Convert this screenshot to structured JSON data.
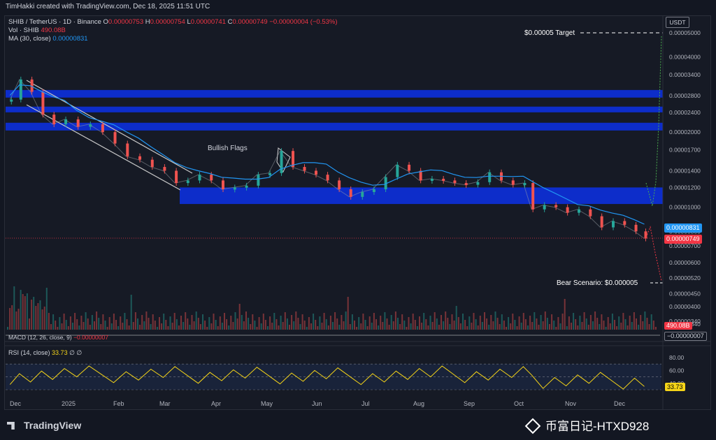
{
  "header": {
    "credit": "TimHakki created with TradingView.com, Dec 18, 2025 11:51 UTC"
  },
  "legend": {
    "symbol": "SHIB / TetherUS · 1D · Binance",
    "o_label": "O",
    "o_value": "0.00000753",
    "h_label": "H",
    "h_value": "0.00000754",
    "l_label": "L",
    "l_value": "0.00000741",
    "c_label": "C",
    "c_value": "0.00000749",
    "change": "−0.00000004 (−0.53%)",
    "vol_label": "Vol · SHIB",
    "vol_value": "490.08B",
    "ma_label": "MA (30, close)",
    "ma_value": "0.00000831"
  },
  "currency": "USDT",
  "price_tags": {
    "ma": "0.00000831",
    "close": "0.00000749",
    "volume": "490.08B",
    "macd": "−0.00000007",
    "rsi": "33.73"
  },
  "panes": {
    "macd_label": "MACD (12, 26, close, 9)",
    "macd_value": "−0.00000007",
    "rsi_label": "RSI (14, close)",
    "rsi_value": "33.73",
    "rsi_extra": "∅ ∅"
  },
  "footer": {
    "logo": "TradingView",
    "watermark": "币富日记-HTXD928"
  },
  "colors": {
    "up": "#26a69a",
    "down": "#ef5350",
    "zone": "#0d2fd8",
    "ma": "#2196f3",
    "rsi": "#f5d418",
    "bg": "#161a25"
  },
  "chart_data": {
    "type": "line",
    "title": "SHIB / TetherUS · 1D · Binance",
    "scale": "log",
    "y_ticks": [
      "0.00005000",
      "0.00004000",
      "0.00003400",
      "0.00002800",
      "0.00002400",
      "0.00002000",
      "0.00001700",
      "0.00001400",
      "0.00001200",
      "0.00001000",
      "0.00000800",
      "0.00000700",
      "0.00000600",
      "0.00000520",
      "0.00000450",
      "0.00000400",
      "0.00000340"
    ],
    "rsi_ticks": [
      "80.00",
      "60.00",
      "40.00"
    ],
    "x_ticks": [
      "Dec",
      "2025",
      "Feb",
      "Mar",
      "Apr",
      "May",
      "Jun",
      "Jul",
      "Aug",
      "Sep",
      "Oct",
      "Nov",
      "Dec"
    ],
    "annotations": {
      "target": "$0.00005 Target",
      "bear": "Bear Scenario: $0.000005",
      "flag": "Bullish Flags"
    },
    "series": [
      {
        "name": "SHIB / TetherUS",
        "points": [
          [
            "Dec 2",
            2.7e-05
          ],
          [
            "Dec 8",
            3.25e-05
          ],
          [
            "Dec 15",
            2.9e-05
          ],
          [
            "Dec 22",
            2.35e-05
          ],
          [
            "Dec 29",
            2.15e-05
          ],
          [
            "Jan 5",
            2.25e-05
          ],
          [
            "Jan 12",
            2.1e-05
          ],
          [
            "Jan 19",
            2.15e-05
          ],
          [
            "Jan 26",
            2e-05
          ],
          [
            "Feb 2",
            1.8e-05
          ],
          [
            "Feb 9",
            1.6e-05
          ],
          [
            "Feb 16",
            1.55e-05
          ],
          [
            "Feb 23",
            1.45e-05
          ],
          [
            "Mar 2",
            1.4e-05
          ],
          [
            "Mar 9",
            1.25e-05
          ],
          [
            "Mar 16",
            1.28e-05
          ],
          [
            "Mar 23",
            1.35e-05
          ],
          [
            "Mar 30",
            1.28e-05
          ],
          [
            "Apr 6",
            1.18e-05
          ],
          [
            "Apr 13",
            1.2e-05
          ],
          [
            "Apr 20",
            1.22e-05
          ],
          [
            "Apr 27",
            1.35e-05
          ],
          [
            "May 4",
            1.37e-05
          ],
          [
            "May 11",
            1.68e-05
          ],
          [
            "May 18",
            1.45e-05
          ],
          [
            "May 25",
            1.4e-05
          ],
          [
            "Jun 1",
            1.35e-05
          ],
          [
            "Jun 8",
            1.28e-05
          ],
          [
            "Jun 15",
            1.18e-05
          ],
          [
            "Jun 22",
            1.1e-05
          ],
          [
            "Jun 29",
            1.15e-05
          ],
          [
            "Jul 6",
            1.18e-05
          ],
          [
            "Jul 13",
            1.32e-05
          ],
          [
            "Jul 20",
            1.48e-05
          ],
          [
            "Jul 27",
            1.4e-05
          ],
          [
            "Aug 3",
            1.28e-05
          ],
          [
            "Aug 10",
            1.3e-05
          ],
          [
            "Aug 17",
            1.28e-05
          ],
          [
            "Aug 24",
            1.25e-05
          ],
          [
            "Aug 31",
            1.23e-05
          ],
          [
            "Sep 7",
            1.26e-05
          ],
          [
            "Sep 14",
            1.38e-05
          ],
          [
            "Sep 21",
            1.28e-05
          ],
          [
            "Sep 28",
            1.23e-05
          ],
          [
            "Oct 5",
            1.25e-05
          ],
          [
            "Oct 10",
            9.8e-06
          ],
          [
            "Oct 17",
            1.02e-05
          ],
          [
            "Oct 24",
            1e-05
          ],
          [
            "Oct 31",
            9.5e-06
          ],
          [
            "Nov 7",
            9.8e-06
          ],
          [
            "Nov 14",
            9.2e-06
          ],
          [
            "Nov 21",
            8.3e-06
          ],
          [
            "Nov 28",
            8.8e-06
          ],
          [
            "Dec 5",
            8.5e-06
          ],
          [
            "Dec 12",
            8e-06
          ],
          [
            "Dec 18",
            7.49e-06
          ]
        ]
      }
    ],
    "legend": "top-left",
    "grid": true
  }
}
